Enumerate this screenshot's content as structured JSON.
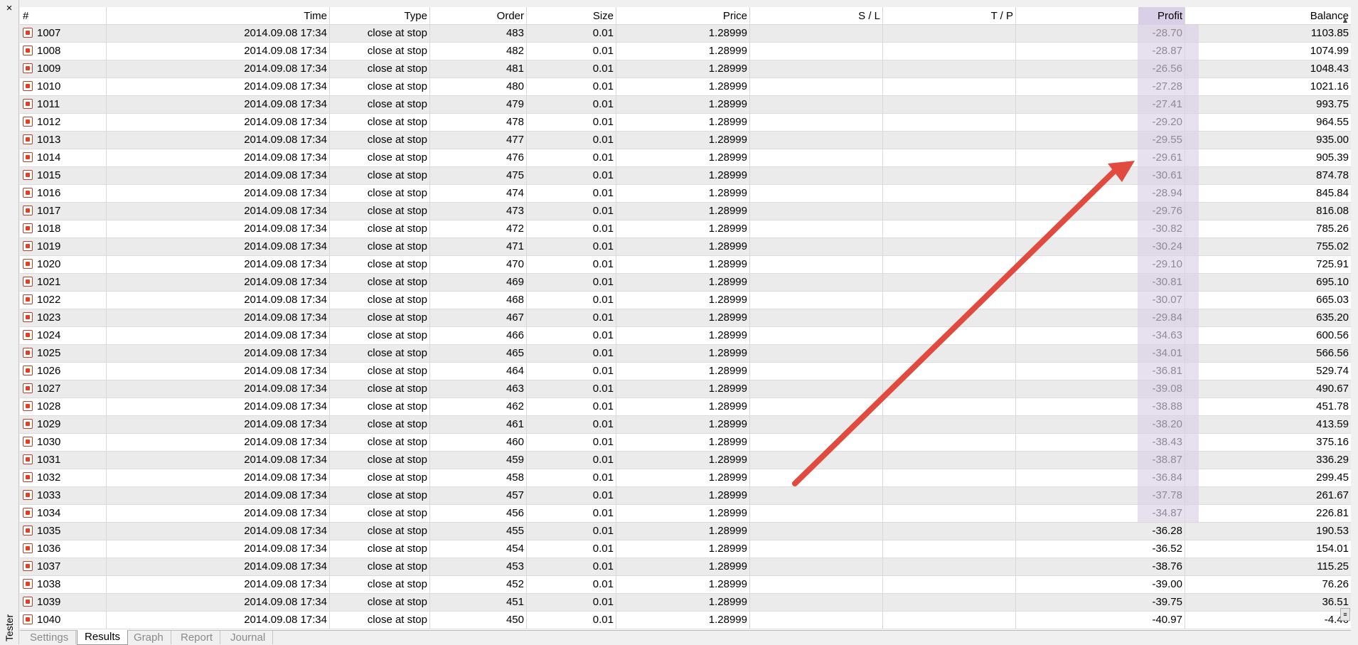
{
  "window": {
    "close_glyph": "×",
    "side_label": "Tester"
  },
  "columns": {
    "num": "#",
    "time": "Time",
    "type": "Type",
    "order": "Order",
    "size": "Size",
    "price": "Price",
    "sl": "S / L",
    "tp": "T / P",
    "profit": "Profit",
    "balance": "Balance"
  },
  "rows": [
    {
      "num": "1007",
      "time": "2014.09.08 17:34",
      "type": "close at stop",
      "order": "483",
      "size": "0.01",
      "price": "1.28999",
      "sl": "",
      "tp": "",
      "profit": "-28.70",
      "balance": "1103.85"
    },
    {
      "num": "1008",
      "time": "2014.09.08 17:34",
      "type": "close at stop",
      "order": "482",
      "size": "0.01",
      "price": "1.28999",
      "sl": "",
      "tp": "",
      "profit": "-28.87",
      "balance": "1074.99"
    },
    {
      "num": "1009",
      "time": "2014.09.08 17:34",
      "type": "close at stop",
      "order": "481",
      "size": "0.01",
      "price": "1.28999",
      "sl": "",
      "tp": "",
      "profit": "-26.56",
      "balance": "1048.43"
    },
    {
      "num": "1010",
      "time": "2014.09.08 17:34",
      "type": "close at stop",
      "order": "480",
      "size": "0.01",
      "price": "1.28999",
      "sl": "",
      "tp": "",
      "profit": "-27.28",
      "balance": "1021.16"
    },
    {
      "num": "1011",
      "time": "2014.09.08 17:34",
      "type": "close at stop",
      "order": "479",
      "size": "0.01",
      "price": "1.28999",
      "sl": "",
      "tp": "",
      "profit": "-27.41",
      "balance": "993.75"
    },
    {
      "num": "1012",
      "time": "2014.09.08 17:34",
      "type": "close at stop",
      "order": "478",
      "size": "0.01",
      "price": "1.28999",
      "sl": "",
      "tp": "",
      "profit": "-29.20",
      "balance": "964.55"
    },
    {
      "num": "1013",
      "time": "2014.09.08 17:34",
      "type": "close at stop",
      "order": "477",
      "size": "0.01",
      "price": "1.28999",
      "sl": "",
      "tp": "",
      "profit": "-29.55",
      "balance": "935.00"
    },
    {
      "num": "1014",
      "time": "2014.09.08 17:34",
      "type": "close at stop",
      "order": "476",
      "size": "0.01",
      "price": "1.28999",
      "sl": "",
      "tp": "",
      "profit": "-29.61",
      "balance": "905.39"
    },
    {
      "num": "1015",
      "time": "2014.09.08 17:34",
      "type": "close at stop",
      "order": "475",
      "size": "0.01",
      "price": "1.28999",
      "sl": "",
      "tp": "",
      "profit": "-30.61",
      "balance": "874.78"
    },
    {
      "num": "1016",
      "time": "2014.09.08 17:34",
      "type": "close at stop",
      "order": "474",
      "size": "0.01",
      "price": "1.28999",
      "sl": "",
      "tp": "",
      "profit": "-28.94",
      "balance": "845.84"
    },
    {
      "num": "1017",
      "time": "2014.09.08 17:34",
      "type": "close at stop",
      "order": "473",
      "size": "0.01",
      "price": "1.28999",
      "sl": "",
      "tp": "",
      "profit": "-29.76",
      "balance": "816.08"
    },
    {
      "num": "1018",
      "time": "2014.09.08 17:34",
      "type": "close at stop",
      "order": "472",
      "size": "0.01",
      "price": "1.28999",
      "sl": "",
      "tp": "",
      "profit": "-30.82",
      "balance": "785.26"
    },
    {
      "num": "1019",
      "time": "2014.09.08 17:34",
      "type": "close at stop",
      "order": "471",
      "size": "0.01",
      "price": "1.28999",
      "sl": "",
      "tp": "",
      "profit": "-30.24",
      "balance": "755.02"
    },
    {
      "num": "1020",
      "time": "2014.09.08 17:34",
      "type": "close at stop",
      "order": "470",
      "size": "0.01",
      "price": "1.28999",
      "sl": "",
      "tp": "",
      "profit": "-29.10",
      "balance": "725.91"
    },
    {
      "num": "1021",
      "time": "2014.09.08 17:34",
      "type": "close at stop",
      "order": "469",
      "size": "0.01",
      "price": "1.28999",
      "sl": "",
      "tp": "",
      "profit": "-30.81",
      "balance": "695.10"
    },
    {
      "num": "1022",
      "time": "2014.09.08 17:34",
      "type": "close at stop",
      "order": "468",
      "size": "0.01",
      "price": "1.28999",
      "sl": "",
      "tp": "",
      "profit": "-30.07",
      "balance": "665.03"
    },
    {
      "num": "1023",
      "time": "2014.09.08 17:34",
      "type": "close at stop",
      "order": "467",
      "size": "0.01",
      "price": "1.28999",
      "sl": "",
      "tp": "",
      "profit": "-29.84",
      "balance": "635.20"
    },
    {
      "num": "1024",
      "time": "2014.09.08 17:34",
      "type": "close at stop",
      "order": "466",
      "size": "0.01",
      "price": "1.28999",
      "sl": "",
      "tp": "",
      "profit": "-34.63",
      "balance": "600.56"
    },
    {
      "num": "1025",
      "time": "2014.09.08 17:34",
      "type": "close at stop",
      "order": "465",
      "size": "0.01",
      "price": "1.28999",
      "sl": "",
      "tp": "",
      "profit": "-34.01",
      "balance": "566.56"
    },
    {
      "num": "1026",
      "time": "2014.09.08 17:34",
      "type": "close at stop",
      "order": "464",
      "size": "0.01",
      "price": "1.28999",
      "sl": "",
      "tp": "",
      "profit": "-36.81",
      "balance": "529.74"
    },
    {
      "num": "1027",
      "time": "2014.09.08 17:34",
      "type": "close at stop",
      "order": "463",
      "size": "0.01",
      "price": "1.28999",
      "sl": "",
      "tp": "",
      "profit": "-39.08",
      "balance": "490.67"
    },
    {
      "num": "1028",
      "time": "2014.09.08 17:34",
      "type": "close at stop",
      "order": "462",
      "size": "0.01",
      "price": "1.28999",
      "sl": "",
      "tp": "",
      "profit": "-38.88",
      "balance": "451.78"
    },
    {
      "num": "1029",
      "time": "2014.09.08 17:34",
      "type": "close at stop",
      "order": "461",
      "size": "0.01",
      "price": "1.28999",
      "sl": "",
      "tp": "",
      "profit": "-38.20",
      "balance": "413.59"
    },
    {
      "num": "1030",
      "time": "2014.09.08 17:34",
      "type": "close at stop",
      "order": "460",
      "size": "0.01",
      "price": "1.28999",
      "sl": "",
      "tp": "",
      "profit": "-38.43",
      "balance": "375.16"
    },
    {
      "num": "1031",
      "time": "2014.09.08 17:34",
      "type": "close at stop",
      "order": "459",
      "size": "0.01",
      "price": "1.28999",
      "sl": "",
      "tp": "",
      "profit": "-38.87",
      "balance": "336.29"
    },
    {
      "num": "1032",
      "time": "2014.09.08 17:34",
      "type": "close at stop",
      "order": "458",
      "size": "0.01",
      "price": "1.28999",
      "sl": "",
      "tp": "",
      "profit": "-36.84",
      "balance": "299.45"
    },
    {
      "num": "1033",
      "time": "2014.09.08 17:34",
      "type": "close at stop",
      "order": "457",
      "size": "0.01",
      "price": "1.28999",
      "sl": "",
      "tp": "",
      "profit": "-37.78",
      "balance": "261.67"
    },
    {
      "num": "1034",
      "time": "2014.09.08 17:34",
      "type": "close at stop",
      "order": "456",
      "size": "0.01",
      "price": "1.28999",
      "sl": "",
      "tp": "",
      "profit": "-34.87",
      "balance": "226.81"
    },
    {
      "num": "1035",
      "time": "2014.09.08 17:34",
      "type": "close at stop",
      "order": "455",
      "size": "0.01",
      "price": "1.28999",
      "sl": "",
      "tp": "",
      "profit": "-36.28",
      "balance": "190.53"
    },
    {
      "num": "1036",
      "time": "2014.09.08 17:34",
      "type": "close at stop",
      "order": "454",
      "size": "0.01",
      "price": "1.28999",
      "sl": "",
      "tp": "",
      "profit": "-36.52",
      "balance": "154.01"
    },
    {
      "num": "1037",
      "time": "2014.09.08 17:34",
      "type": "close at stop",
      "order": "453",
      "size": "0.01",
      "price": "1.28999",
      "sl": "",
      "tp": "",
      "profit": "-38.76",
      "balance": "115.25"
    },
    {
      "num": "1038",
      "time": "2014.09.08 17:34",
      "type": "close at stop",
      "order": "452",
      "size": "0.01",
      "price": "1.28999",
      "sl": "",
      "tp": "",
      "profit": "-39.00",
      "balance": "76.26"
    },
    {
      "num": "1039",
      "time": "2014.09.08 17:34",
      "type": "close at stop",
      "order": "451",
      "size": "0.01",
      "price": "1.28999",
      "sl": "",
      "tp": "",
      "profit": "-39.75",
      "balance": "36.51"
    },
    {
      "num": "1040",
      "time": "2014.09.08 17:34",
      "type": "close at stop",
      "order": "450",
      "size": "0.01",
      "price": "1.28999",
      "sl": "",
      "tp": "",
      "profit": "-40.97",
      "balance": "-4.46"
    }
  ],
  "highlight": {
    "rows_highlighted": 28,
    "color": "#d9cfe6"
  },
  "annotation": {
    "shape": "arrow",
    "color": "#e04a3f",
    "points_to": "profit column"
  },
  "row_icon": "order-close-icon",
  "tabs": [
    {
      "label": "Settings",
      "active": false
    },
    {
      "label": "Results",
      "active": true
    },
    {
      "label": "Graph",
      "active": false
    },
    {
      "label": "Report",
      "active": false
    },
    {
      "label": "Journal",
      "active": false
    }
  ],
  "scrollbar": {
    "up_glyph": "▲",
    "grip_glyph": "≡"
  }
}
